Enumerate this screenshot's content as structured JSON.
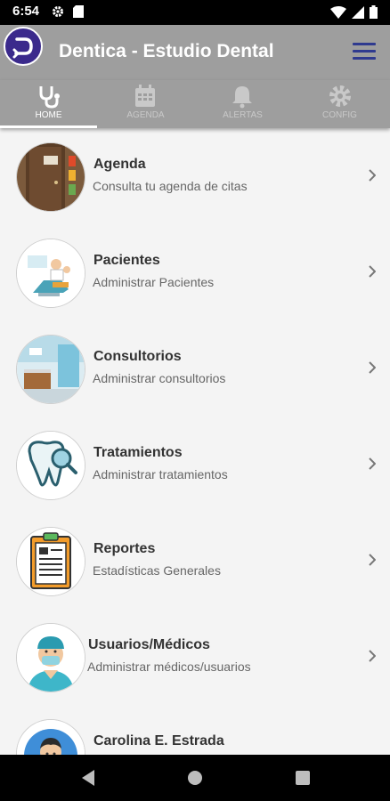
{
  "status_bar": {
    "time": "6:54"
  },
  "app": {
    "title": "Dentica - Estudio Dental"
  },
  "tabs": [
    {
      "label": "HOME",
      "icon": "stethoscope-icon",
      "active": true
    },
    {
      "label": "AGENDA",
      "icon": "calendar-icon",
      "active": false
    },
    {
      "label": "ALERTAS",
      "icon": "bell-icon",
      "active": false
    },
    {
      "label": "CONFIG",
      "icon": "gear-icon",
      "active": false
    }
  ],
  "menu": [
    {
      "title": "Agenda",
      "subtitle": "Consulta tu agenda de citas",
      "icon": "door-icon"
    },
    {
      "title": "Pacientes",
      "subtitle": "Administrar Pacientes",
      "icon": "dental-chair-icon"
    },
    {
      "title": "Consultorios",
      "subtitle": "Administrar consultorios",
      "icon": "clinic-room-icon"
    },
    {
      "title": "Tratamientos",
      "subtitle": "Administrar tratamientos",
      "icon": "tooth-magnifier-icon"
    },
    {
      "title": "Reportes",
      "subtitle": "Estadísticas Generales",
      "icon": "clipboard-icon"
    },
    {
      "title": "Usuarios/Médicos",
      "subtitle": "Administrar médicos/usuarios",
      "icon": "doctor-icon"
    }
  ],
  "profile": {
    "name": "Carolina E. Estrada"
  },
  "colors": {
    "appbar": "#9e9e9e",
    "accent": "#2f3a8f",
    "logo": "#3b2a8c"
  }
}
